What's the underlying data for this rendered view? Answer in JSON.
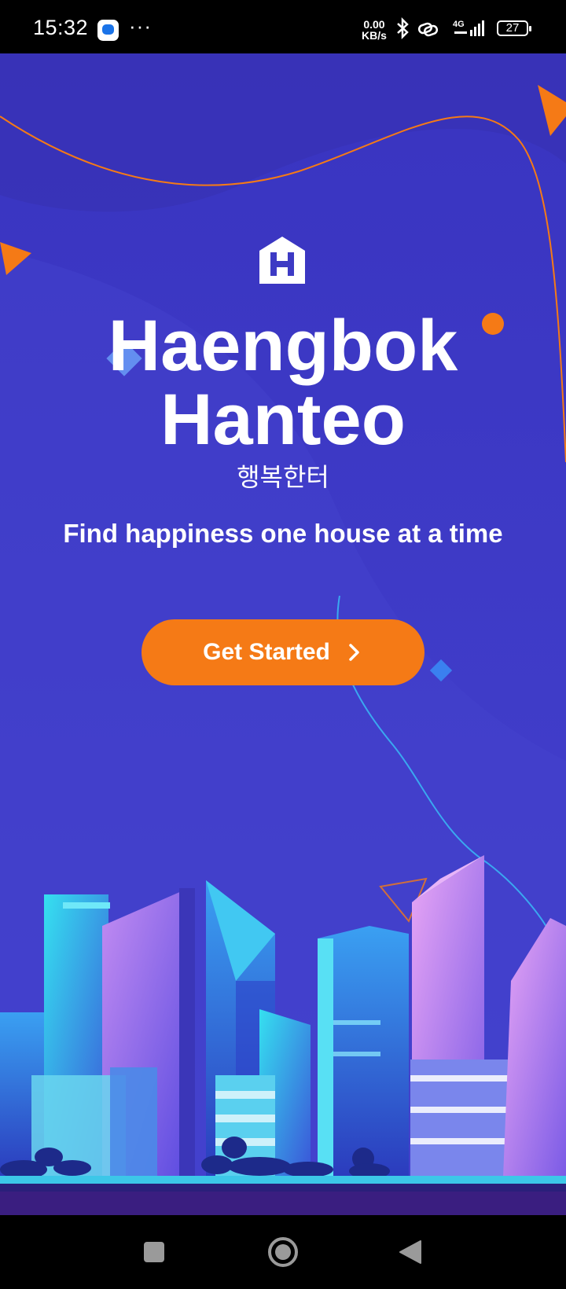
{
  "status_bar": {
    "time": "15:32",
    "dots": "···",
    "net_speed_value": "0.00",
    "net_speed_unit": "KB/s",
    "network": "4G",
    "battery": "27"
  },
  "app": {
    "title_line1": "Haengbok",
    "title_line2": "Hanteo",
    "subtitle_korean": "행복한터",
    "tagline": "Find happiness one house at a time",
    "cta_label": "Get Started"
  },
  "colors": {
    "background": "#3d3ac4",
    "accent": "#f57a16",
    "text": "#ffffff"
  },
  "icons": {
    "logo": "house-h-logo",
    "cta": "chevron-right-icon",
    "nav": [
      "square-icon",
      "circle-icon",
      "triangle-back-icon"
    ]
  }
}
